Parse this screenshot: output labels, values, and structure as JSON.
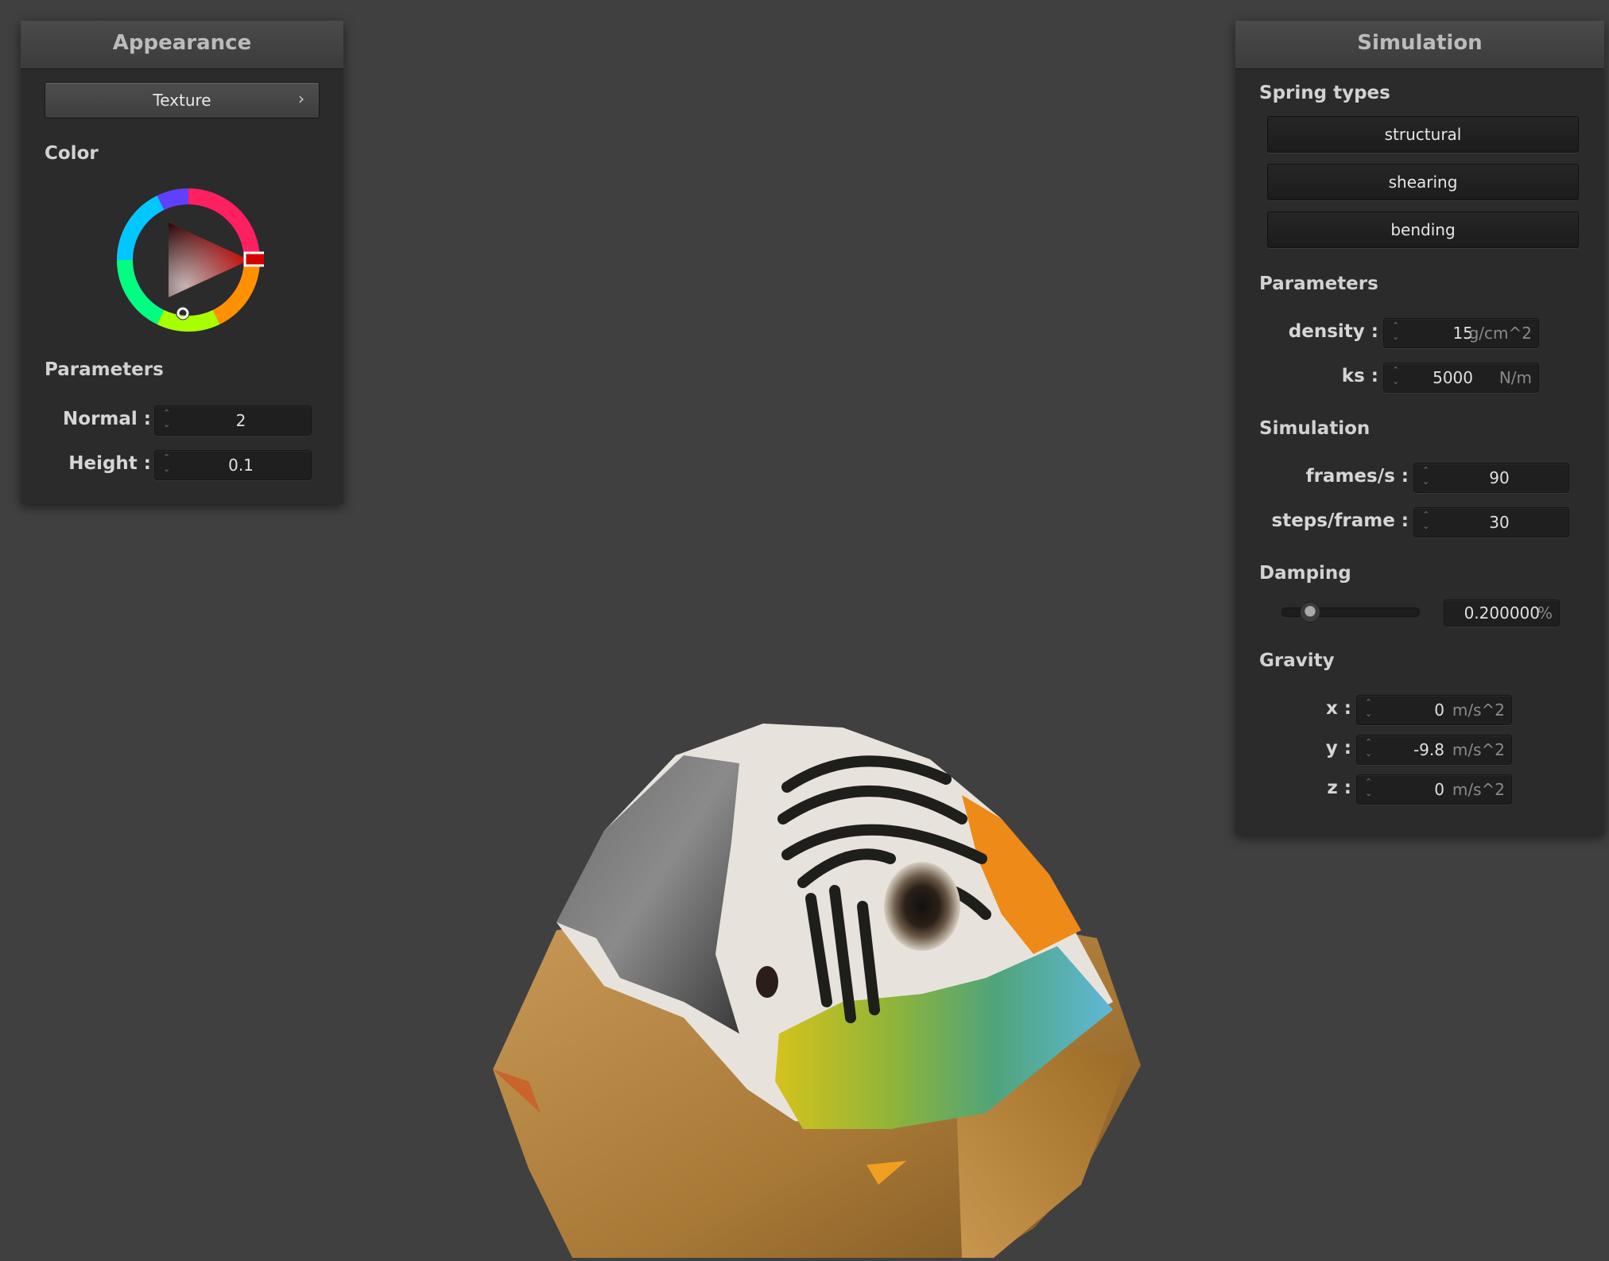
{
  "appearance": {
    "title": "Appearance",
    "texture_button": "Texture",
    "color_label": "Color",
    "selected_color": "#cc0000",
    "parameters_label": "Parameters",
    "normal_label": "Normal :",
    "normal_value": "2",
    "height_label": "Height :",
    "height_value": "0.1"
  },
  "simulation": {
    "title": "Simulation",
    "spring_types_label": "Spring types",
    "spring_buttons": [
      "structural",
      "shearing",
      "bending"
    ],
    "parameters_label": "Parameters",
    "density_label": "density :",
    "density_value": "15",
    "density_unit": "g/cm^2",
    "ks_label": "ks :",
    "ks_value": "5000",
    "ks_unit": "N/m",
    "simulation_label": "Simulation",
    "fps_label": "frames/s :",
    "fps_value": "90",
    "steps_label": "steps/frame :",
    "steps_value": "30",
    "damping_label": "Damping",
    "damping_value": "0.200000",
    "damping_unit": "%",
    "damping_level": 0.2,
    "gravity_label": "Gravity",
    "gx_label": "x :",
    "gx_value": "0",
    "gy_label": "y :",
    "gy_value": "-9.8",
    "gz_label": "z :",
    "gz_value": "0",
    "gravity_unit": "m/s^2"
  },
  "colors": {
    "background": "#404040",
    "panel": "#2b2b2b",
    "header": "#424242"
  }
}
